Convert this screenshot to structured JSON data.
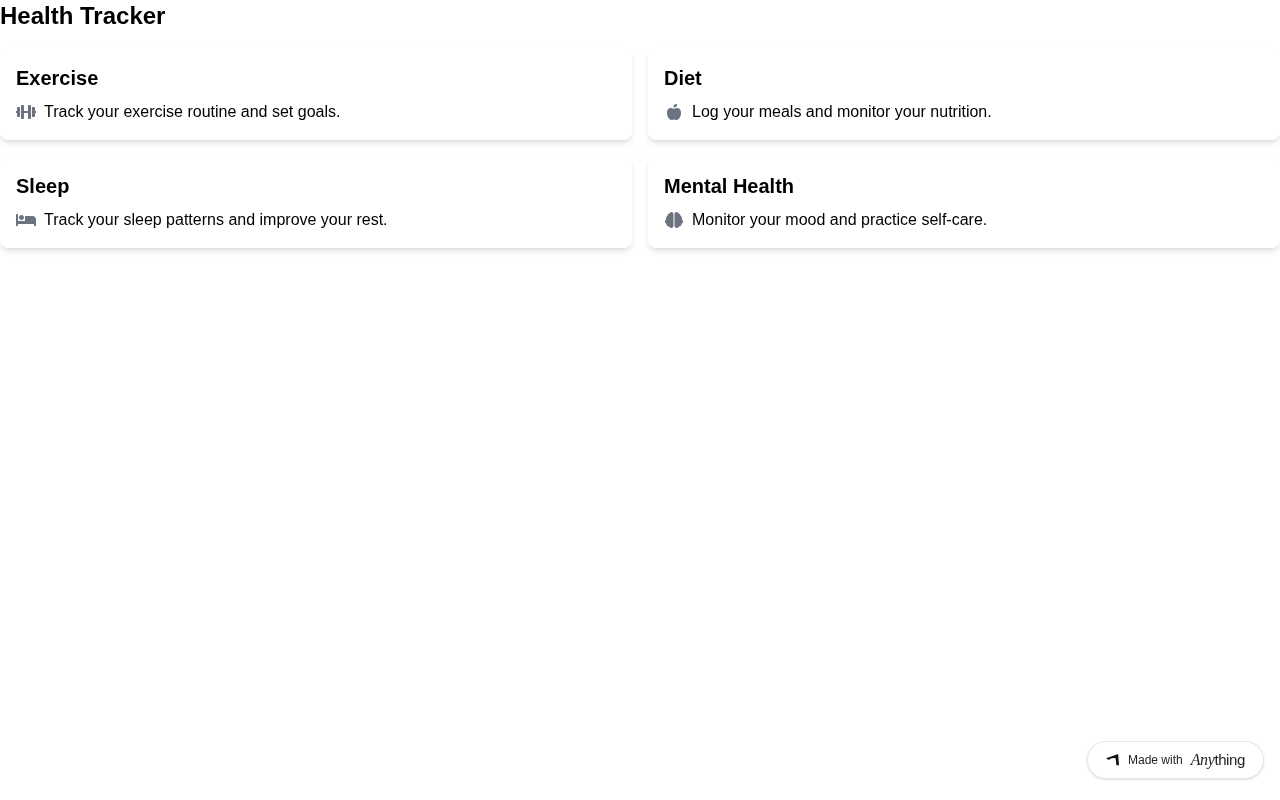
{
  "title": "Health Tracker",
  "cards": [
    {
      "title": "Exercise",
      "description": "Track your exercise routine and set goals."
    },
    {
      "title": "Diet",
      "description": "Log your meals and monitor your nutrition."
    },
    {
      "title": "Sleep",
      "description": "Track your sleep patterns and improve your rest."
    },
    {
      "title": "Mental Health",
      "description": "Monitor your mood and practice self-care."
    }
  ],
  "badge": {
    "label": "Made with",
    "logo": [
      {
        "kind": "script",
        "text": "Any"
      },
      {
        "kind": "plain",
        "text": "thing"
      }
    ]
  }
}
